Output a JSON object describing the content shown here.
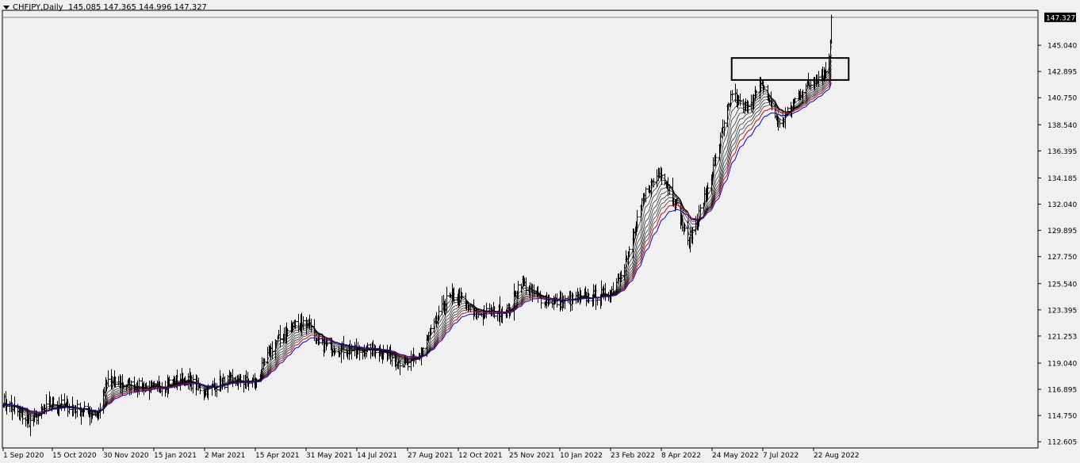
{
  "header": {
    "symbol": "CHFJPY,Daily",
    "ohlc": "145.085 147.365 144.996 147.327"
  },
  "current_price_label": "147.327",
  "chart_data": {
    "type": "ohlc-bar",
    "symbol": "CHFJPY",
    "timeframe": "Daily",
    "y_ticks": [
      "147.327",
      "145.040",
      "142.895",
      "140.750",
      "138.540",
      "136.395",
      "134.185",
      "132.040",
      "129.895",
      "127.750",
      "125.540",
      "123.395",
      "121.253",
      "119.040",
      "116.895",
      "114.750",
      "112.605"
    ],
    "x_ticks": [
      "1 Sep 2020",
      "15 Oct 2020",
      "30 Nov 2020",
      "15 Jan 2021",
      "2 Mar 2021",
      "15 Apr 2021",
      "31 May 2021",
      "14 Jul 2021",
      "27 Aug 2021",
      "12 Oct 2021",
      "25 Nov 2021",
      "10 Jan 2022",
      "23 Feb 2022",
      "8 Apr 2022",
      "24 May 2022",
      "7 Jul 2022",
      "22 Aug 2022"
    ],
    "ylim": [
      112.1,
      147.9
    ],
    "path_anchors": [
      [
        "1 Sep 2020",
        116.0
      ],
      [
        "25 Sep 2020",
        114.2
      ],
      [
        "15 Oct 2020",
        115.8
      ],
      [
        "10 Nov 2020",
        115.2
      ],
      [
        "25 Nov 2020",
        114.8
      ],
      [
        "4 Dec 2020",
        117.6
      ],
      [
        "15 Dec 2020",
        117.3
      ],
      [
        "15 Jan 2021",
        117.0
      ],
      [
        "10 Feb 2021",
        117.8
      ],
      [
        "2 Mar 2021",
        116.8
      ],
      [
        "22 Mar 2021",
        117.6
      ],
      [
        "15 Apr 2021",
        117.5
      ],
      [
        "1 May 2021",
        120.5
      ],
      [
        "20 May 2021",
        122.2
      ],
      [
        "4 Jun 2021",
        122.4
      ],
      [
        "8 Jun 2021",
        120.6
      ],
      [
        "14 Jul 2021",
        120.0
      ],
      [
        "1 Aug 2021",
        120.2
      ],
      [
        "27 Aug 2021",
        118.8
      ],
      [
        "8 Sep 2021",
        119.8
      ],
      [
        "1 Oct 2021",
        124.2
      ],
      [
        "12 Oct 2021",
        124.6
      ],
      [
        "25 Oct 2021",
        123.0
      ],
      [
        "25 Nov 2021",
        123.4
      ],
      [
        "5 Dec 2021",
        125.8
      ],
      [
        "20 Dec 2021",
        124.4
      ],
      [
        "10 Jan 2022",
        124.0
      ],
      [
        "23 Feb 2022",
        124.8
      ],
      [
        "10 Mar 2022",
        127.8
      ],
      [
        "25 Mar 2022",
        133.0
      ],
      [
        "8 Apr 2022",
        134.8
      ],
      [
        "22 Apr 2022",
        131.8
      ],
      [
        "2 May 2022",
        128.8
      ],
      [
        "15 May 2022",
        132.0
      ],
      [
        "24 May 2022",
        134.5
      ],
      [
        "10 Jun 2022",
        141.2
      ],
      [
        "20 Jun 2022",
        139.8
      ],
      [
        "7 Jul 2022",
        141.8
      ],
      [
        "22 Jul 2022",
        138.4
      ],
      [
        "8 Aug 2022",
        141.0
      ],
      [
        "25 Aug 2022",
        142.4
      ],
      [
        "2 Sep 2022",
        142.9
      ],
      [
        "6 Sep 2022",
        145.0
      ],
      [
        "7 Sep 2022",
        147.327
      ]
    ],
    "moving_averages": {
      "black_lines": 8,
      "red_line": "slow moving average (red)",
      "blue_line": "slowest moving average (blue)"
    },
    "annotation_box": {
      "from": "10 Jun 2022",
      "to": "7 Sep 2022",
      "low": 142.2,
      "high": 144.0
    },
    "current_price": 147.327,
    "colors": {
      "background": "#f0f0f0",
      "bars": "#000000",
      "red_ma": "#e00000",
      "blue_ma": "#0000e0",
      "ma": "#000000",
      "price_line": "#6b7f99",
      "label_bg": "#000000",
      "label_text": "#ffffff"
    },
    "grid": false
  }
}
